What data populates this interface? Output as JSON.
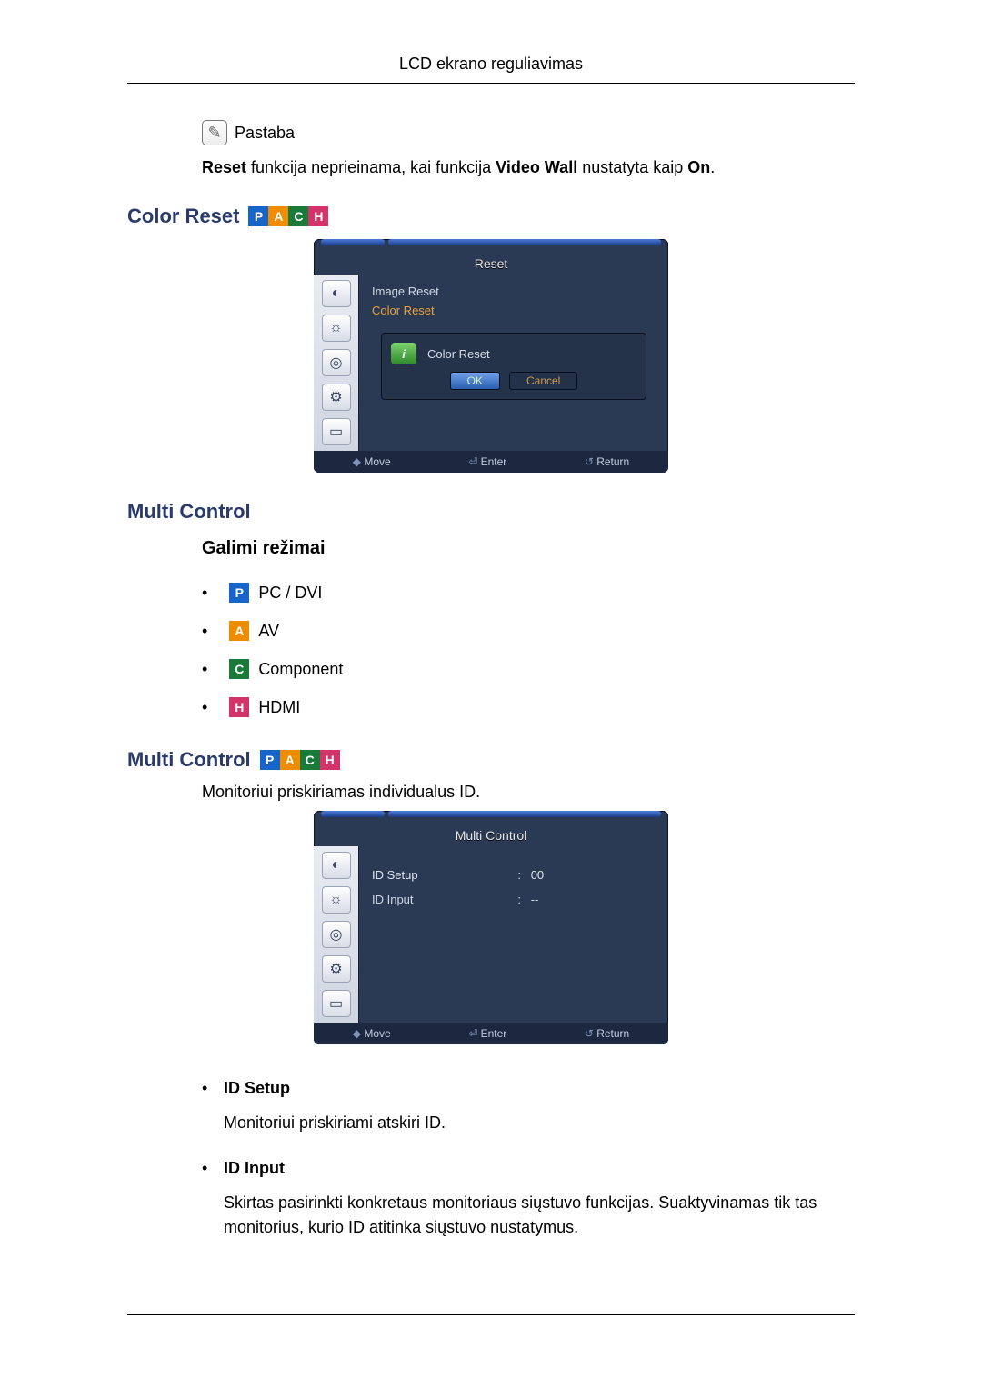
{
  "header": {
    "title": "LCD ekrano reguliavimas"
  },
  "note": {
    "label": "Pastaba",
    "text_prefix": "Reset",
    "text_mid1": " funkcija neprieinama, kai funkcija ",
    "text_bold2": "Video Wall",
    "text_mid2": " nustatyta kaip ",
    "text_bold3": "On",
    "text_suffix": "."
  },
  "sections": {
    "color_reset": {
      "title": "Color Reset",
      "badges": [
        "P",
        "A",
        "C",
        "H"
      ]
    },
    "multi_control_head": {
      "title": "Multi Control"
    },
    "available_modes": {
      "title": "Galimi režimai",
      "items": [
        {
          "badge": "P",
          "label": "PC / DVI"
        },
        {
          "badge": "A",
          "label": "AV"
        },
        {
          "badge": "C",
          "label": "Component"
        },
        {
          "badge": "H",
          "label": "HDMI"
        }
      ]
    },
    "multi_control": {
      "title": "Multi Control",
      "badges": [
        "P",
        "A",
        "C",
        "H"
      ],
      "intro": "Monitoriui priskiriamas individualus ID."
    },
    "id_list": [
      {
        "title": "ID Setup",
        "desc": "Monitoriui priskiriami atskiri ID."
      },
      {
        "title": "ID Input",
        "desc": "Skirtas pasirinkti konkretaus monitoriaus siųstuvo funkcijas. Suaktyvinamas tik tas monitorius, kurio ID atitinka siųstuvo nustatymus."
      }
    ]
  },
  "osd_reset": {
    "title": "Reset",
    "menu": [
      "Image Reset",
      "Color Reset"
    ],
    "dialog": {
      "title": "Color Reset",
      "ok": "OK",
      "cancel": "Cancel"
    },
    "footer": {
      "move": "Move",
      "enter": "Enter",
      "return": "Return"
    }
  },
  "osd_multi": {
    "title": "Multi Control",
    "rows": [
      {
        "label": "ID Setup",
        "sep": ":",
        "value": "00"
      },
      {
        "label": "ID Input",
        "sep": ":",
        "value": "--"
      }
    ],
    "footer": {
      "move": "Move",
      "enter": "Enter",
      "return": "Return"
    }
  }
}
